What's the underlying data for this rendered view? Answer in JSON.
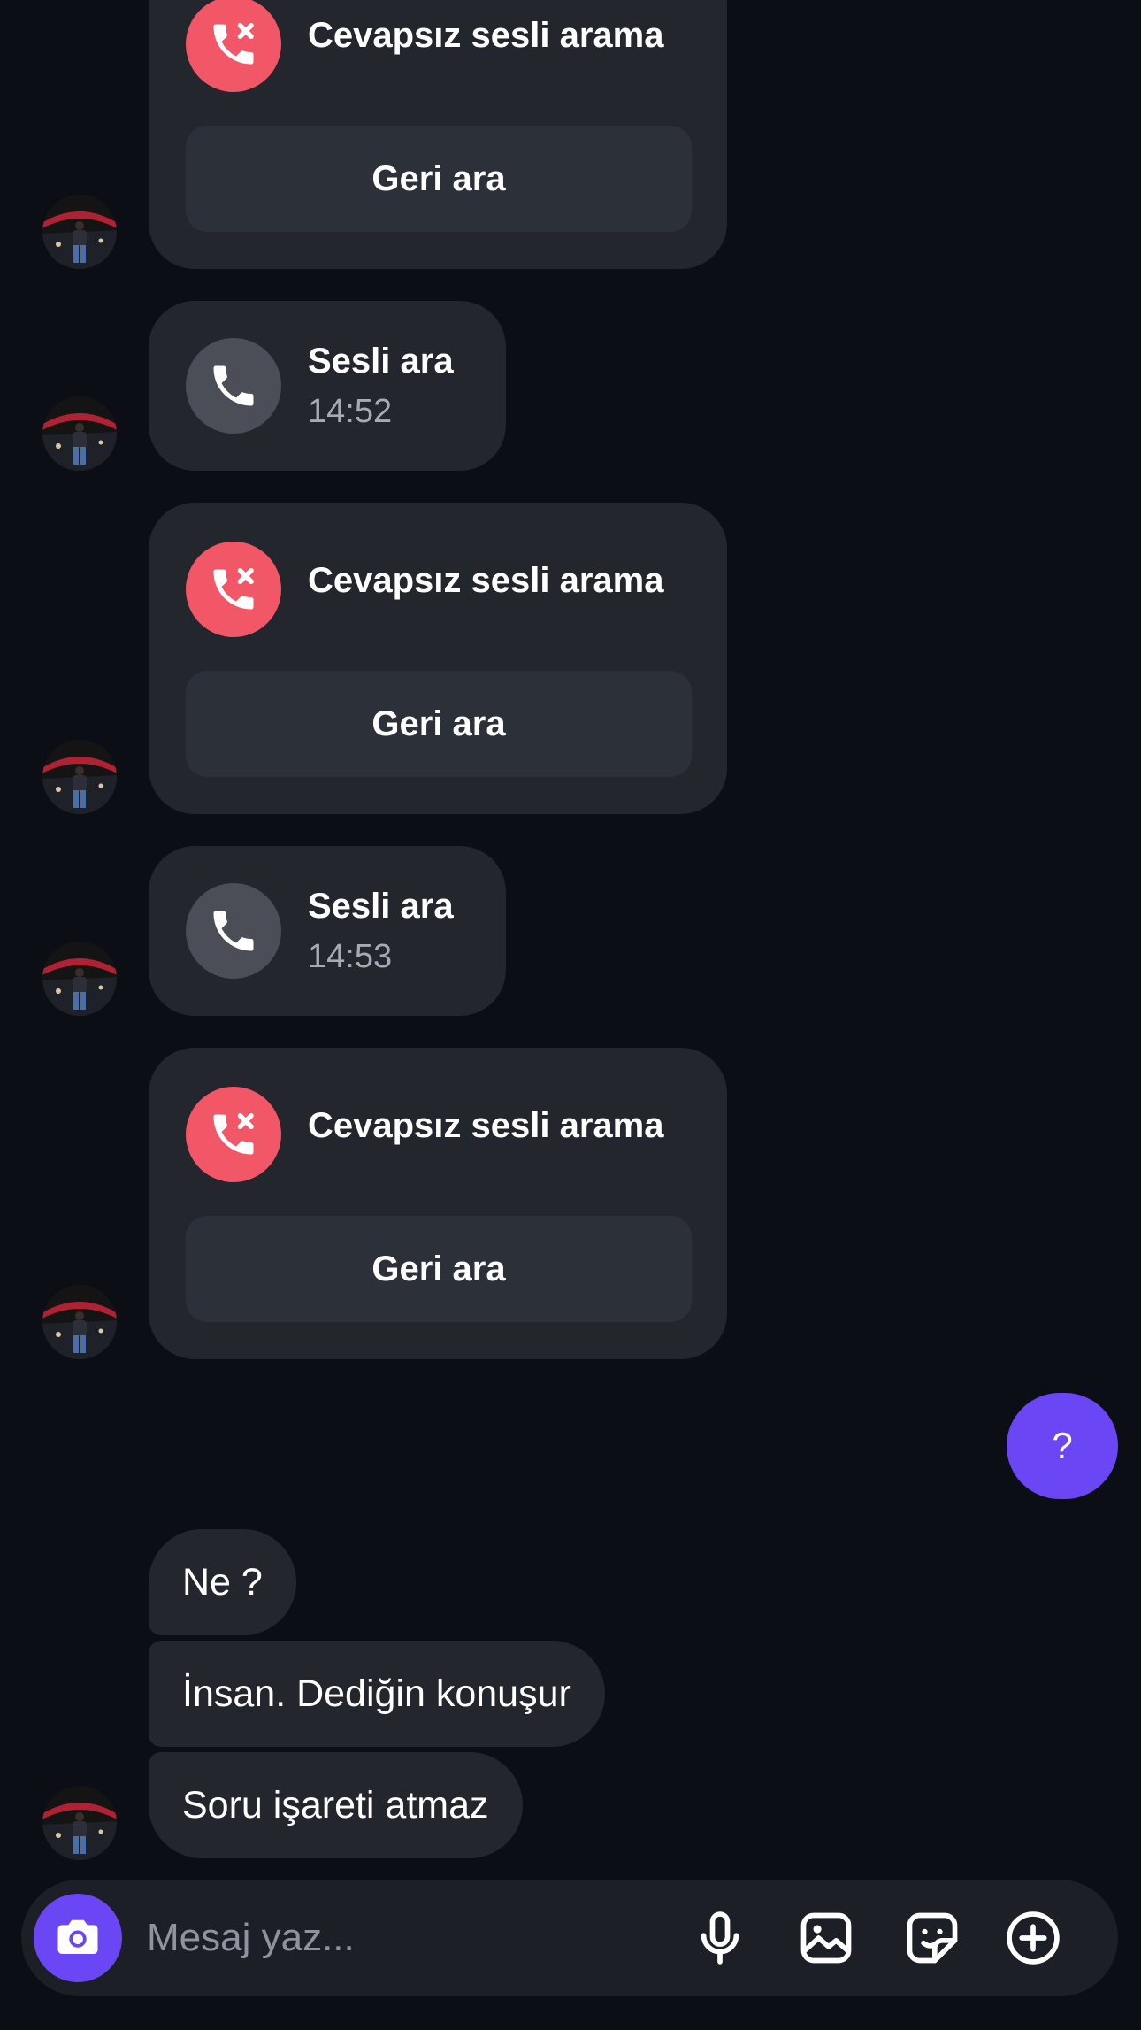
{
  "colors": {
    "background": "#0b0e14",
    "bubble": "#23262d",
    "missed_icon": "#f25768",
    "voice_icon": "#4b4e56",
    "accent": "#6a46f5"
  },
  "messages": [
    {
      "type": "missed_call",
      "title": "Cevapsız sesli arama",
      "action": "Geri ara"
    },
    {
      "type": "voice_call",
      "title": "Sesli ara",
      "time": "14:52"
    },
    {
      "type": "missed_call",
      "title": "Cevapsız sesli arama",
      "action": "Geri ara"
    },
    {
      "type": "voice_call",
      "title": "Sesli ara",
      "time": "14:53"
    },
    {
      "type": "missed_call",
      "title": "Cevapsız sesli arama",
      "action": "Geri ara"
    },
    {
      "type": "sent_text",
      "text": "?"
    },
    {
      "type": "received_text",
      "text": "Ne ?"
    },
    {
      "type": "received_text",
      "text": "İnsan. Dediğin konuşur"
    },
    {
      "type": "received_text",
      "text": "Soru işareti atmaz"
    }
  ],
  "composer": {
    "placeholder": "Mesaj yaz...",
    "icons": [
      "camera-icon",
      "microphone-icon",
      "gallery-icon",
      "sticker-icon",
      "plus-circle-icon"
    ]
  }
}
